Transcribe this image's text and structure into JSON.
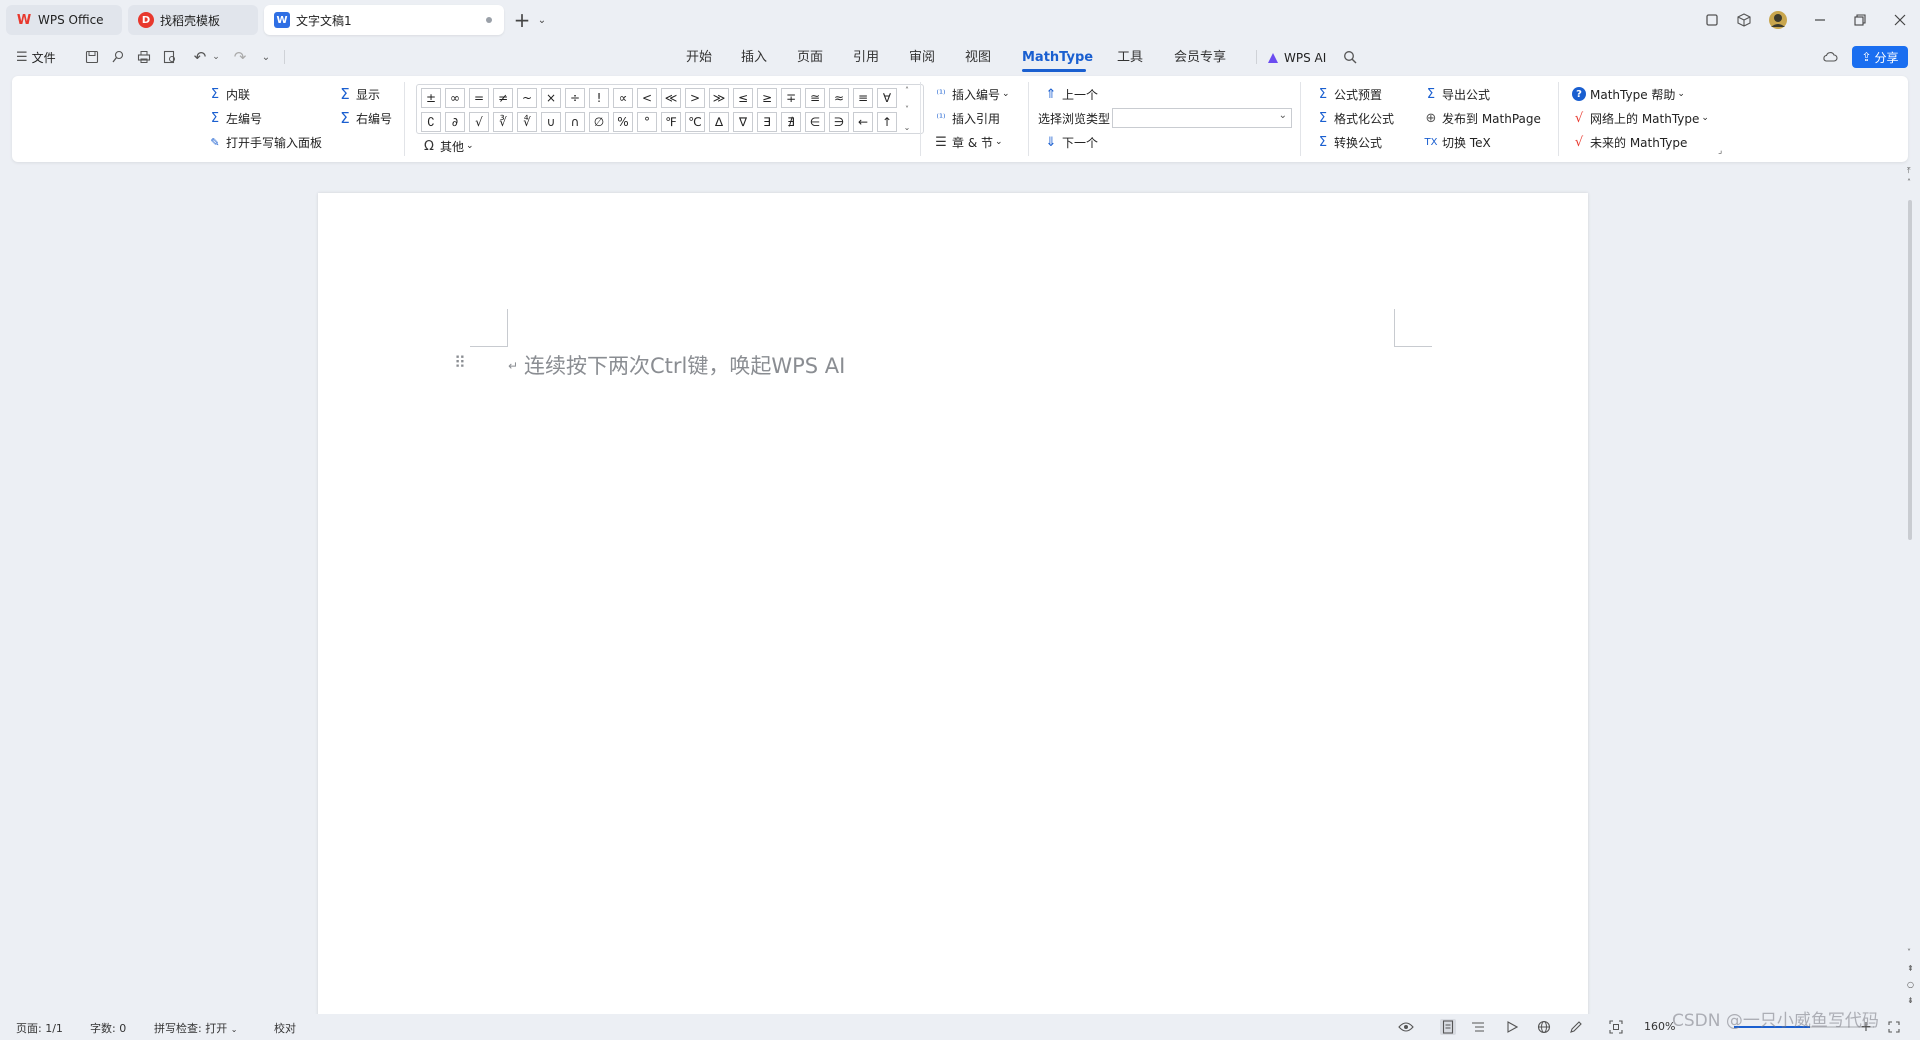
{
  "tabs": [
    {
      "label": "WPS Office",
      "icon": "wps-logo-icon"
    },
    {
      "label": "找稻壳模板",
      "icon": "docer-icon"
    },
    {
      "label": "文字文稿1",
      "icon": "word-doc-icon"
    }
  ],
  "menu": {
    "file_label": "文件",
    "tabs": [
      "开始",
      "插入",
      "页面",
      "引用",
      "审阅",
      "视图",
      "MathType",
      "工具",
      "会员专享"
    ],
    "active_tab": "MathType",
    "wps_ai_label": "WPS AI",
    "share_label": "分享"
  },
  "ribbon": {
    "inline_label": "内联",
    "display_label": "显示",
    "left_number_label": "左编号",
    "right_number_label": "右编号",
    "handwrite_label": "打开手写输入面板",
    "symbols_row1": [
      "±",
      "∞",
      "=",
      "≠",
      "~",
      "×",
      "÷",
      "!",
      "∝",
      "<",
      "≪",
      ">",
      "≫",
      "≤",
      "≥",
      "∓",
      "≅",
      "≈",
      "≡",
      "∀"
    ],
    "symbols_row2": [
      "∁",
      "∂",
      "√",
      "∛",
      "∜",
      "∪",
      "∩",
      "∅",
      "%",
      "°",
      "℉",
      "℃",
      "∆",
      "∇",
      "∃",
      "∄",
      "∈",
      "∋",
      "←",
      "↑"
    ],
    "other_label": "其他",
    "insert_number_label": "插入编号",
    "insert_ref_label": "插入引用",
    "chapter_label": "章 & 节",
    "prev_label": "上一个",
    "browse_type_label": "选择浏览类型",
    "browse_type_value": "",
    "next_label": "下一个",
    "presets_label": "公式预置",
    "format_label": "格式化公式",
    "convert_label": "转换公式",
    "export_label": "导出公式",
    "publish_label": "发布到 MathPage",
    "toggle_tex_label": "切换 TeX",
    "help_label": "MathType 帮助",
    "online_label": "网络上的 MathType",
    "future_label": "未来的 MathType"
  },
  "document": {
    "hint_text": "连续按下两次Ctrl键，唤起WPS AI"
  },
  "status": {
    "page": "页面: 1/1",
    "words": "字数: 0",
    "spell": "拼写检查: 打开",
    "proof": "校对",
    "zoom": "160%"
  },
  "watermark": "CSDN @一只小威鱼写代码",
  "colors": {
    "accent": "#1a5fd0",
    "wps_red": "#e8382d",
    "background": "#eceff4"
  }
}
